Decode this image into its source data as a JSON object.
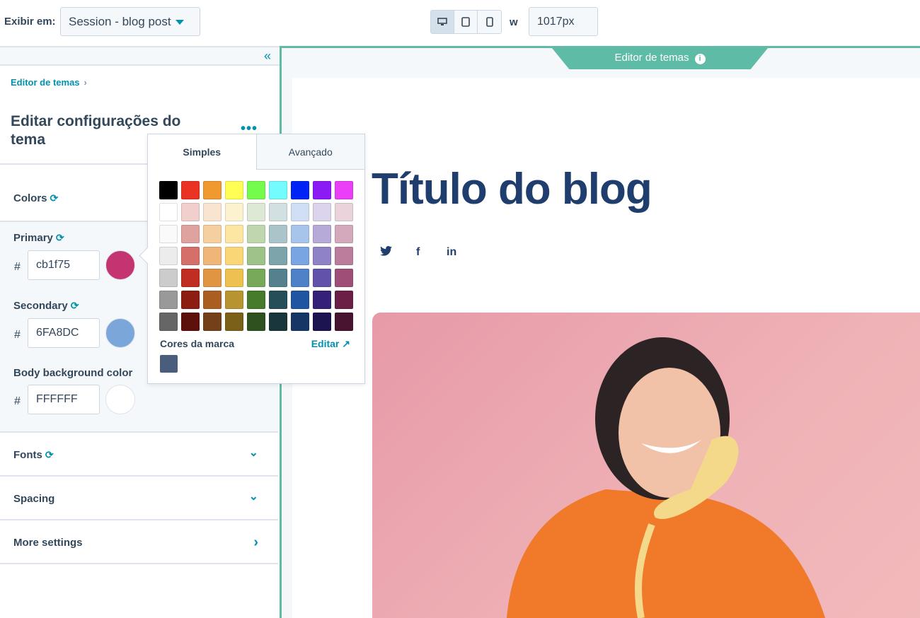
{
  "topbar": {
    "view_label": "Exibir em:",
    "view_select": "Session - blog post",
    "width_label": "w",
    "width_value": "1017px",
    "devices": [
      "desktop-icon",
      "tablet-icon",
      "mobile-icon"
    ]
  },
  "sidebar": {
    "collapse_icon": "«",
    "breadcrumb": "Editor de temas",
    "breadcrumb_sep": "›",
    "title": "Editar configurações do tema",
    "more_icon": "•••",
    "colors": {
      "label": "Colors",
      "primary": {
        "label": "Primary",
        "value": "cb1f75",
        "swatch": "#c43470"
      },
      "secondary": {
        "label": "Secondary",
        "value": "6FA8DC",
        "swatch": "#7aa6da"
      },
      "body_bg": {
        "label": "Body background color",
        "value": "FFFFFF",
        "swatch": "#ffffff"
      },
      "hash": "#"
    },
    "sections": [
      {
        "label": "Fonts",
        "chevron": "⌄"
      },
      {
        "label": "Spacing",
        "chevron": "⌄"
      },
      {
        "label": "More settings",
        "chevron": "›"
      }
    ]
  },
  "picker": {
    "tabs": [
      "Simples",
      "Avançado"
    ],
    "palette": [
      [
        "#000000",
        "#ea3323",
        "#f0992e",
        "#fffe54",
        "#75fb4c",
        "#73fbfd",
        "#0023f5",
        "#8b1af5",
        "#ea3ff7"
      ],
      [
        "#ffffff",
        "#f0cfcd",
        "#f9e5cf",
        "#fdf2d0",
        "#dde8d5",
        "#d3e0e2",
        "#d0dff4",
        "#dbd4ec",
        "#ebd3dc"
      ],
      [
        "#fafafa",
        "#e0a29f",
        "#f4cf9f",
        "#fde5a2",
        "#bfd6ae",
        "#aac5ca",
        "#a7c5ea",
        "#b5aad8",
        "#d4a9bc"
      ],
      [
        "#ececec",
        "#d46f6a",
        "#efb677",
        "#fbd676",
        "#9ec389",
        "#7ea4ab",
        "#79a5e2",
        "#8f82c5",
        "#bc7d9c"
      ],
      [
        "#cccccc",
        "#c02d22",
        "#df9542",
        "#ecc151",
        "#78a95a",
        "#54818b",
        "#4d82c8",
        "#6252a8",
        "#9f4f77"
      ],
      [
        "#999999",
        "#8d1d13",
        "#aa5f21",
        "#b89430",
        "#467b2b",
        "#264e59",
        "#1f55a1",
        "#342077",
        "#6c1f46"
      ],
      [
        "#666666",
        "#5e100a",
        "#73401a",
        "#7a6019",
        "#2f5120",
        "#18363b",
        "#163765",
        "#1c1351",
        "#481430"
      ]
    ],
    "brand_label": "Cores da marca",
    "edit_label": "Editar ↗",
    "brand_color": "#4a5d7c"
  },
  "preview": {
    "banner": "Editor de temas",
    "info_icon": "i",
    "blog_title": "Título do blog",
    "social": [
      "twitter-icon",
      "facebook-icon",
      "linkedin-icon"
    ],
    "social_glyphs": [
      "🐦︎",
      "f",
      "in"
    ]
  }
}
